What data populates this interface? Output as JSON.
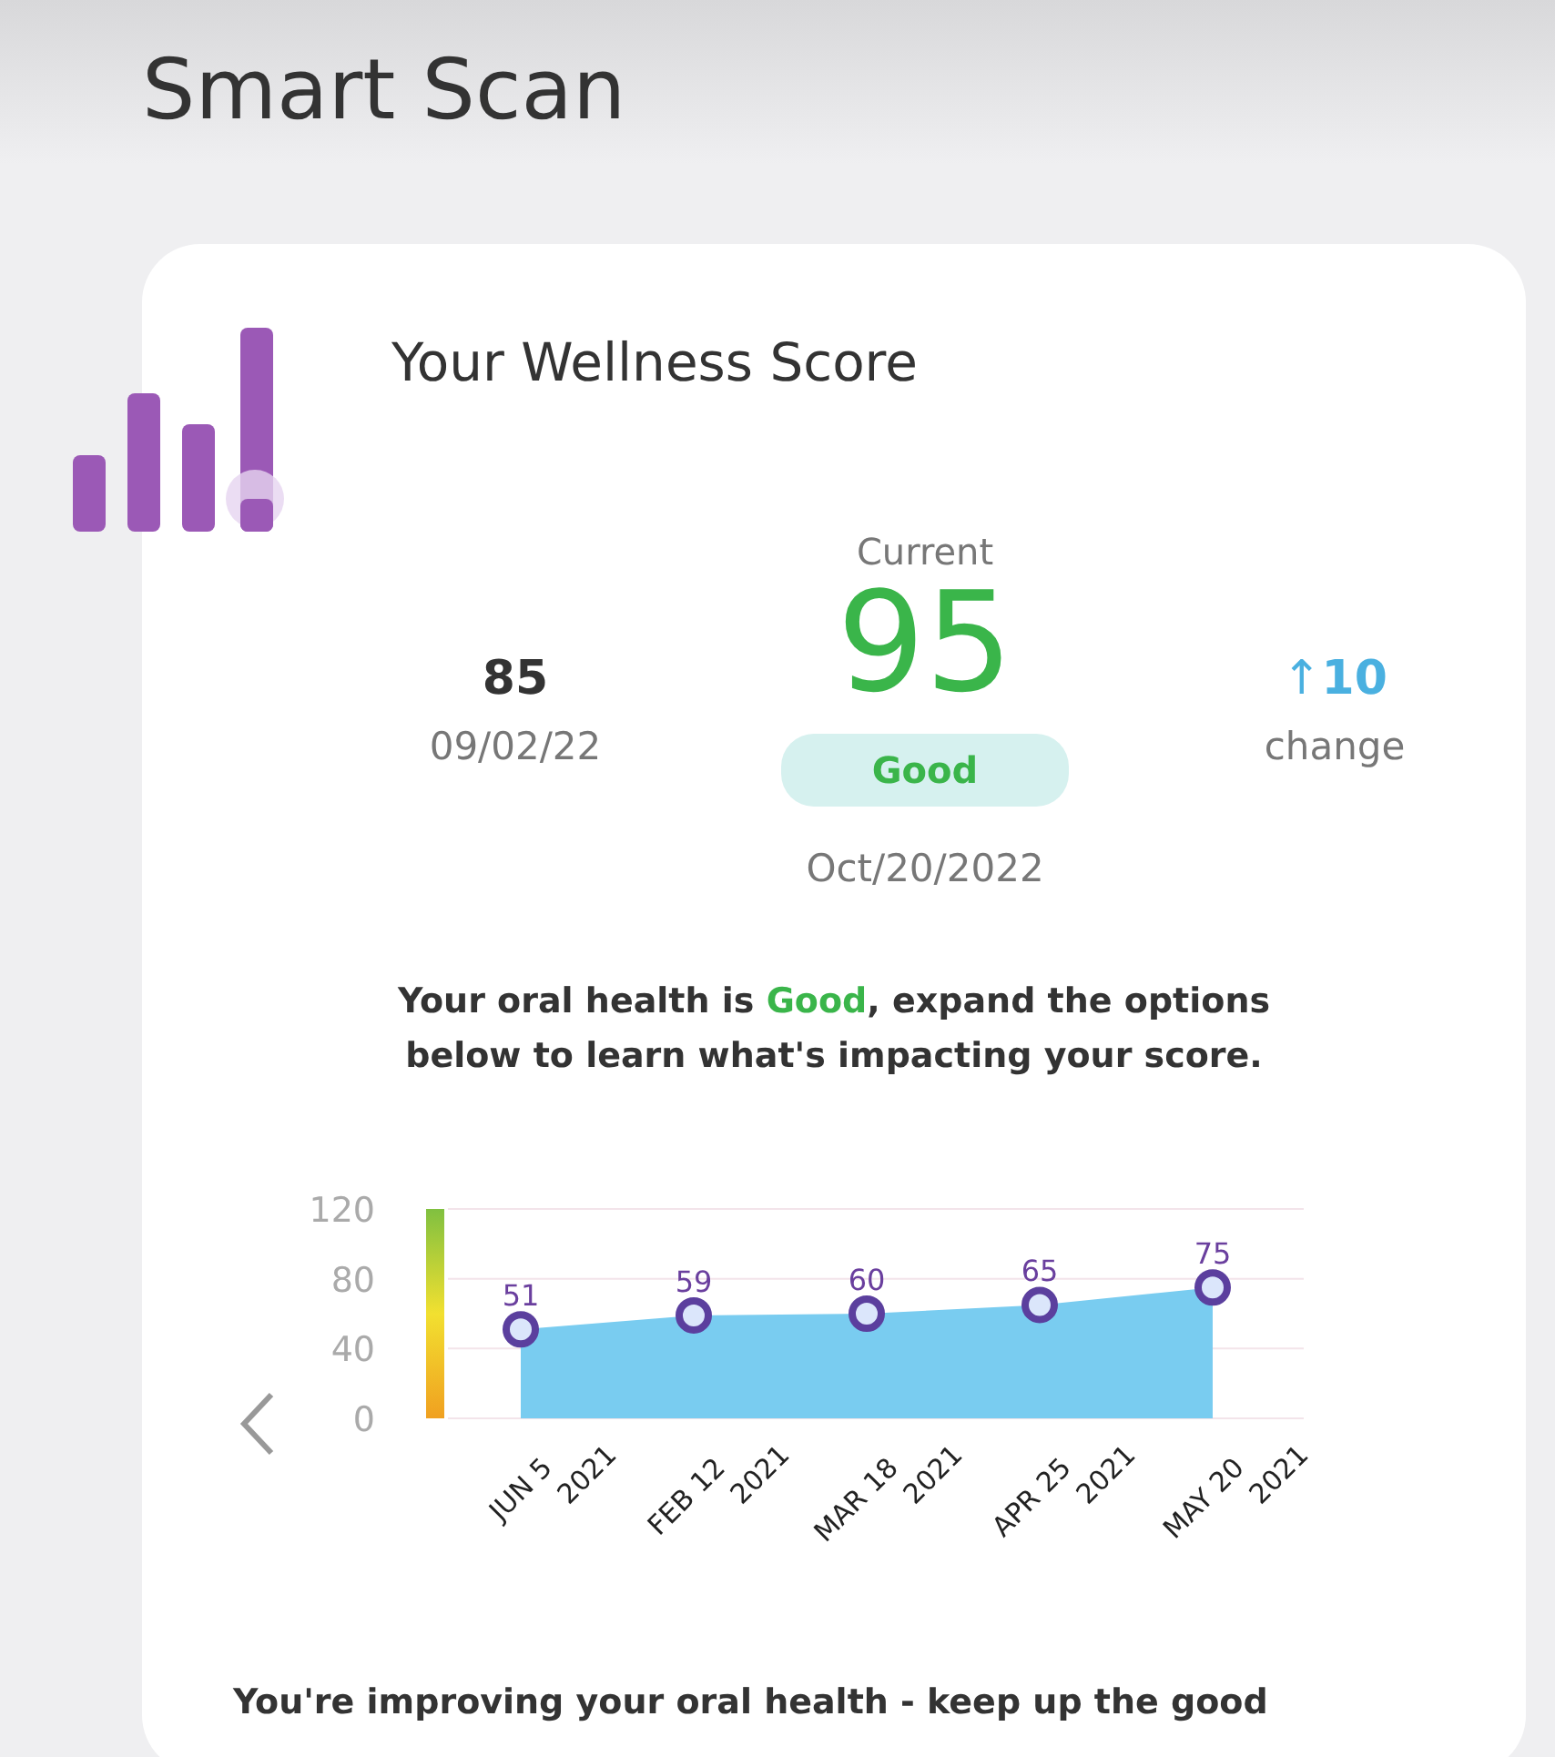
{
  "title": "Smart Scan",
  "card": {
    "title": "Your Wellness Score",
    "previous": {
      "score": "85",
      "date": "09/02/22"
    },
    "current": {
      "label": "Current",
      "score": "95",
      "rating": "Good",
      "date": "Oct/20/2022"
    },
    "change": {
      "arrow": "↑",
      "value": "10",
      "label": "change"
    },
    "message": {
      "before": "Your oral health is ",
      "highlight": "Good",
      "after": ", expand the options below to learn what's impacting your score."
    },
    "chart_data": {
      "type": "area",
      "categories": [
        "JUN 5\n2021",
        "FEB 12\n2021",
        "MAR 18\n2021",
        "APR 25\n2021",
        "MAY 20\n2021"
      ],
      "series": [
        {
          "color": "#79ccf0",
          "values": [
            51,
            59,
            60,
            65,
            75
          ]
        }
      ],
      "ylim": [
        0,
        120
      ],
      "yticks": [
        0,
        40,
        80,
        120
      ],
      "data_labels": true
    },
    "footer": "You're improving your oral health - keep up the good"
  }
}
